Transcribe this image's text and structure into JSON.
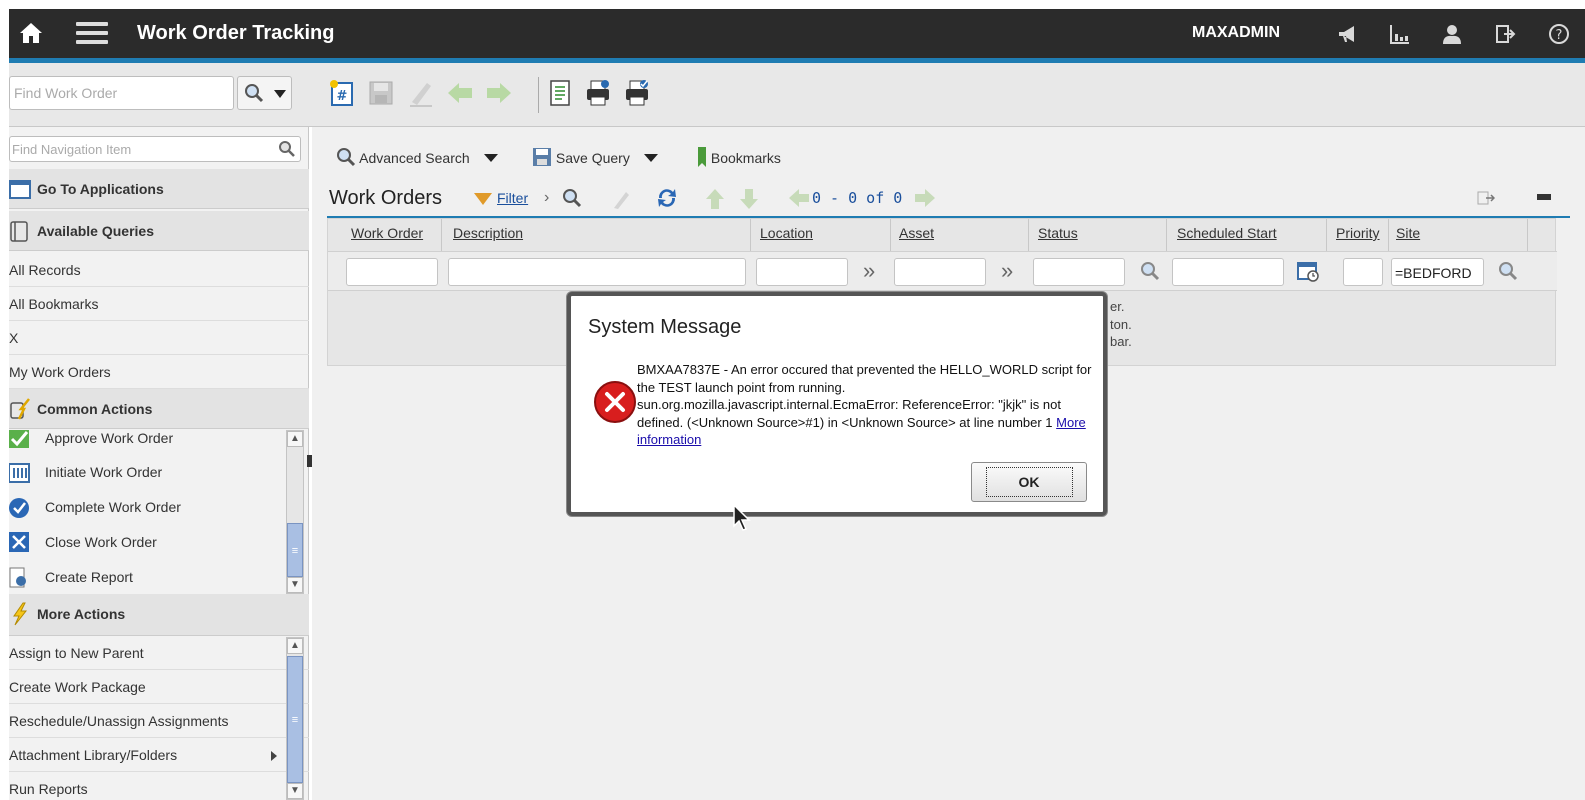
{
  "header": {
    "title": "Work Order Tracking",
    "user": "MAXADMIN",
    "icons": [
      "home-icon",
      "menu-icon",
      "megaphone-icon",
      "chart-icon",
      "profile-icon",
      "logout-icon",
      "help-icon"
    ]
  },
  "toolbar": {
    "find_placeholder": "Find Work Order",
    "icons": [
      "new-record-icon",
      "save-icon",
      "clear-icon",
      "previous-icon",
      "next-icon",
      "report-icon",
      "print-icon",
      "print-attachments-icon"
    ]
  },
  "sidebar": {
    "nav_search_placeholder": "Find Navigation Item",
    "go_to_apps": "Go To Applications",
    "available_queries": {
      "title": "Available Queries",
      "items": [
        "All Records",
        "All Bookmarks",
        "X",
        "My Work Orders"
      ]
    },
    "common_actions": {
      "title": "Common Actions",
      "items": [
        "Approve Work Order",
        "Initiate Work Order",
        "Complete Work Order",
        "Close Work Order",
        "Create Report"
      ]
    },
    "more_actions": {
      "title": "More Actions",
      "items": [
        "Assign to New Parent",
        "Create Work Package",
        "Reschedule/Unassign Assignments",
        "Attachment Library/Folders",
        "Run Reports"
      ]
    }
  },
  "main": {
    "advanced_search": "Advanced Search",
    "save_query": "Save Query",
    "bookmarks": "Bookmarks",
    "table_title": "Work Orders",
    "filter": "Filter",
    "pager": "0 - 0 of 0",
    "columns": [
      "Work Order",
      "Description",
      "Location",
      "Asset",
      "Status",
      "Scheduled Start",
      "Priority",
      "Site"
    ],
    "site_filter_value": "=BEDFORD",
    "hidden_text": [
      "er.",
      "ton.",
      "bar."
    ]
  },
  "dialog": {
    "title": "System Message",
    "message": "BMXAA7837E - An error occured that prevented the HELLO_WORLD script for the TEST launch point from running. sun.org.mozilla.javascript.internal.EcmaError: ReferenceError: \"jkjk\" is not defined. (<Unknown Source>#1) in <Unknown Source> at line number 1",
    "link": "More information",
    "ok": "OK"
  }
}
